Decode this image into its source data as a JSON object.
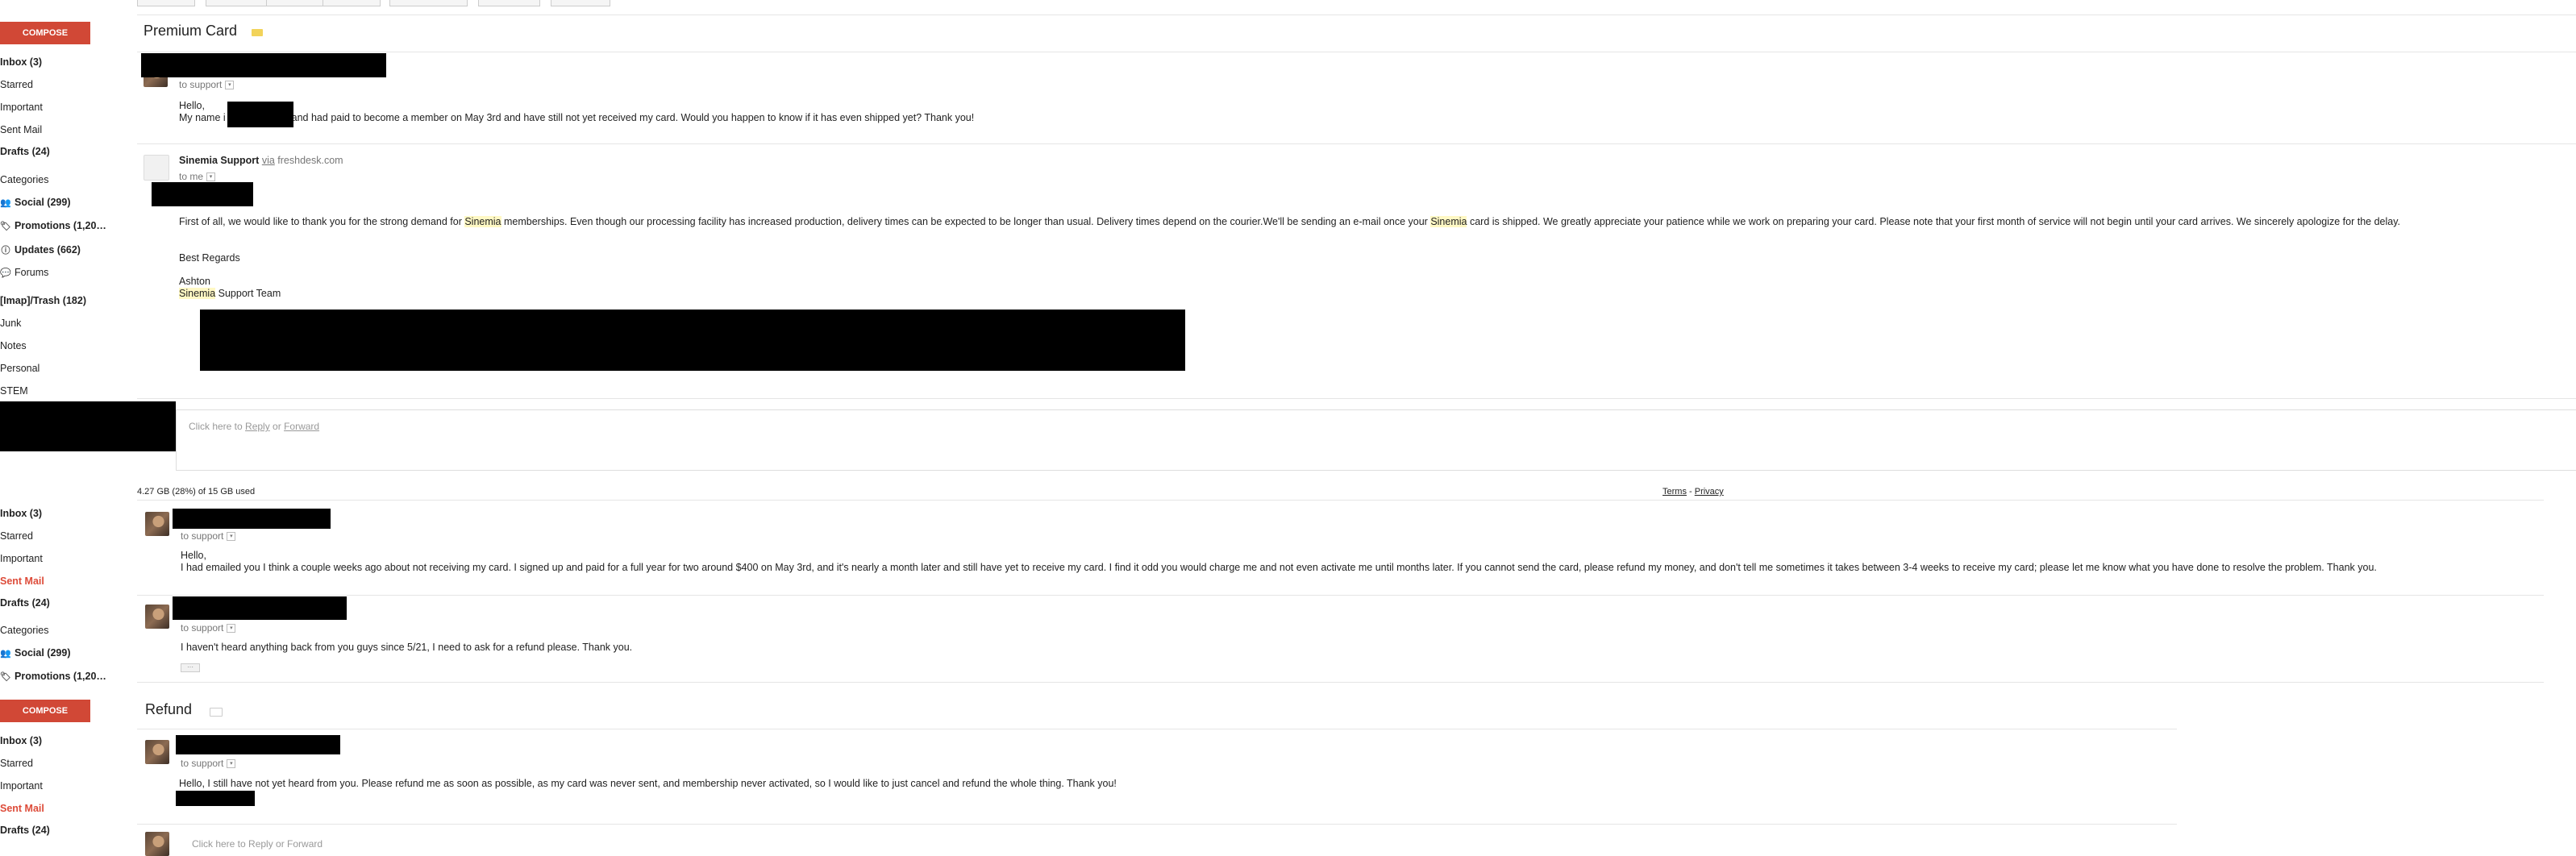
{
  "top_tabs": [
    "",
    "",
    "",
    "",
    "",
    "",
    ""
  ],
  "compose_label": "COMPOSE",
  "nav_a": {
    "inbox": "Inbox (3)",
    "starred": "Starred",
    "important": "Important",
    "sent": "Sent Mail",
    "drafts": "Drafts (24)",
    "categories": "Categories",
    "social": "Social (299)",
    "promotions": "Promotions (1,20…",
    "updates": "Updates (662)",
    "forums": "Forums",
    "trash": "[Imap]/Trash (182)",
    "junk": "Junk",
    "notes": "Notes",
    "personal": "Personal",
    "stem": "STEM"
  },
  "nav_b": {
    "inbox": "Inbox (3)",
    "starred": "Starred",
    "important": "Important",
    "sent": "Sent Mail",
    "drafts": "Drafts (24)",
    "categories": "Categories",
    "social": "Social (299)",
    "promotions": "Promotions (1,20…"
  },
  "nav_c": {
    "inbox": "Inbox (3)",
    "starred": "Starred",
    "important": "Important",
    "sent": "Sent Mail",
    "drafts": "Drafts (24)"
  },
  "thread1": {
    "subject": "Premium Card",
    "msg1": {
      "to": "to support",
      "greeting": "Hello,",
      "line_pre": "My name i",
      "line_post": "and had paid to become a member on May 3rd and have still not yet received my card.  Would you happen to know if it has even shipped yet?  Thank you!"
    },
    "msg2": {
      "sender": "Sinemia Support",
      "via": "via",
      "domain": "freshdesk.com",
      "to": "to me",
      "p1_a": "First of all, we would like to thank you for the strong demand for ",
      "p1_hl1": "Sinemia",
      "p1_b": " memberships. Even though our processing facility has increased production, delivery times can be expected to be longer than usual. Delivery times depend on the courier.We'll be sending an e-mail once your ",
      "p1_hl2": "Sinemia",
      "p1_c": " card is shipped. We greatly appreciate your patience while we work on preparing your card. Please note that your first month of service will not begin until your card arrives. We sincerely apologize for the delay.",
      "regards": "Best Regards",
      "name": "Ashton",
      "team_hl": "Sinemia",
      "team_rest": " Support Team"
    },
    "reply": {
      "click": "Click here to ",
      "reply": "Reply",
      "or": " or ",
      "forward": "Forward"
    }
  },
  "storage": {
    "used": "4.27 GB (28%) of 15 GB used",
    "terms": "Terms",
    "sep": " - ",
    "privacy": "Privacy"
  },
  "thread1b": {
    "msg3": {
      "to": "to support",
      "greeting": "Hello,",
      "body": "I had emailed you I think a couple weeks ago about not receiving my card.  I signed up and paid for a full year for two around $400 on May 3rd, and it's nearly a month later and still have yet to receive my card.  I find it odd you would charge me and not even activate me until months later.  If you cannot send the card, please refund my money, and don't tell me sometimes it takes between 3-4 weeks to receive my card; please let me know what you have done to resolve the problem.  Thank you."
    },
    "msg4": {
      "to": "to support",
      "body": "I haven't heard anything back from you guys since 5/21, I need to ask for a refund please.  Thank you.",
      "ellipsis": "···"
    }
  },
  "thread2": {
    "subject": "Refund",
    "msg1": {
      "to": "to support",
      "body": "Hello, I still have not yet heard from you.  Please refund me as soon as possible, as my card was never sent, and membership never activated, so I would like to just cancel and refund the whole thing.  Thank you!"
    },
    "reply": "Click here to Reply or Forward"
  }
}
